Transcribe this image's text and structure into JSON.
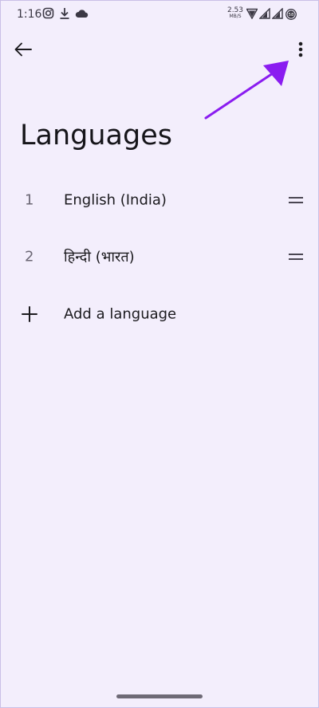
{
  "status_bar": {
    "time": "1:16",
    "net_speed_value": "2.53",
    "net_speed_unit": "MB/S",
    "battery_level": "58",
    "icons": [
      "instagram-icon",
      "download-icon",
      "cloud-icon",
      "wifi-icon",
      "signal-icon",
      "signal-icon",
      "battery-icon"
    ]
  },
  "app_bar": {
    "back_icon": "arrow-left-icon",
    "more_icon": "more-vert-icon"
  },
  "page": {
    "title": "Languages"
  },
  "languages": [
    {
      "index": "1",
      "name": "English (India)"
    },
    {
      "index": "2",
      "name": "हिन्दी (भारत)"
    }
  ],
  "add_language": {
    "label": "Add a language",
    "icon": "plus-icon"
  },
  "colors": {
    "background": "#f3eefc",
    "annotation_arrow": "#8a1cf0",
    "text_primary": "#1c1b1f",
    "text_secondary": "#6c6875"
  }
}
